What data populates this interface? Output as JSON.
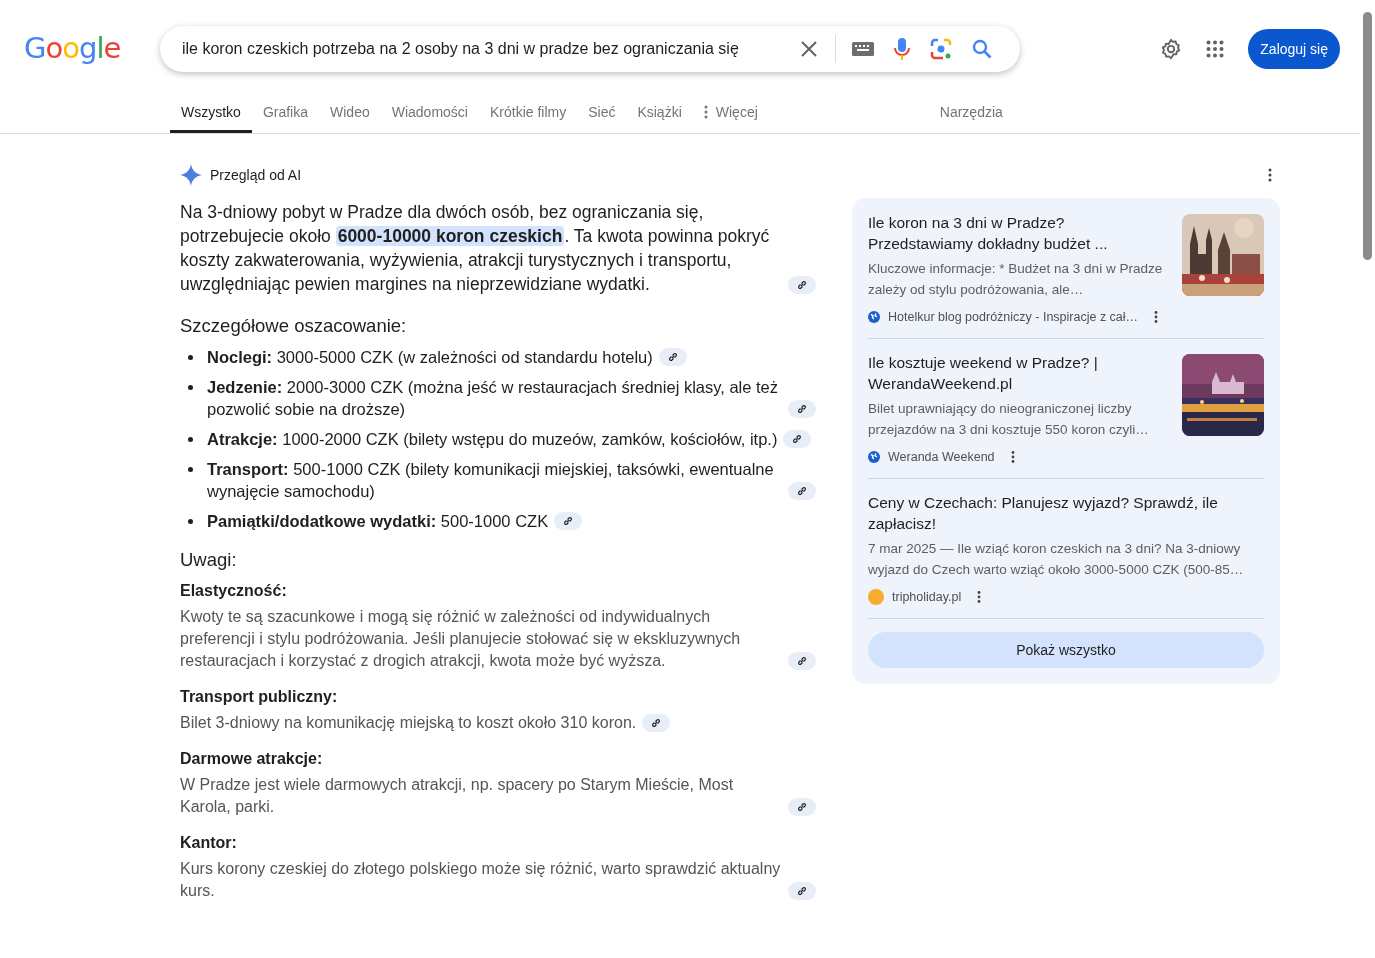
{
  "logo": "Google",
  "search": {
    "value": "ile koron czeskich potrzeba na 2 osoby na 3 dni w pradze bez ograniczania się"
  },
  "sign_in": "Zaloguj się",
  "tabs": [
    {
      "label": "Wszystko",
      "selected": true
    },
    {
      "label": "Grafika",
      "selected": false
    },
    {
      "label": "Wideo",
      "selected": false
    },
    {
      "label": "Wiadomości",
      "selected": false
    },
    {
      "label": "Krótkie filmy",
      "selected": false
    },
    {
      "label": "Sieć",
      "selected": false
    },
    {
      "label": "Książki",
      "selected": false
    },
    {
      "label": "Więcej",
      "selected": false,
      "kind": "more"
    }
  ],
  "tools": "Narzędzia",
  "ai_overview": {
    "title": "Przegląd od AI",
    "summary": "Na 3-dniowy pobyt w Pradze dla dwóch osób, bez ograniczania się, potrzebujecie około **6000-10000 koron czeskich**. Ta kwota powinna pokryć koszty zakwaterowania, wyżywienia, atrakcji turystycznych i transportu, uwzględniając pewien margines na nieprzewidziane wydatki.",
    "details_heading": "Szczegółowe oszacowanie:",
    "details": [
      "**Noclegi:** 3000-5000 CZK (w zależności od standardu hotelu)",
      "**Jedzenie:** 2000-3000 CZK (można jeść w restauracjach średniej klasy, ale też pozwolić sobie na droższe)",
      "**Atrakcje:** 1000-2000 CZK (bilety wstępu do muzeów, zamków, kościołów, itp.)",
      "**Transport:** 500-1000 CZK (bilety komunikacji miejskiej, taksówki, ewentualne wynajęcie samochodu)",
      "**Pamiątki/dodatkowe wydatki:** 500-1000 CZK"
    ],
    "notes_heading": "Uwagi:",
    "notes": [
      {
        "heading": "Elastyczność:",
        "text": "Kwoty te są szacunkowe i mogą się różnić w zależności od indywidualnych preferencji i stylu podróżowania. Jeśli planujecie stołować się w ekskluzywnych restauracjach i korzystać z drogich atrakcji, kwota może być wyższa."
      },
      {
        "heading": "Transport publiczny:",
        "text": "Bilet 3-dniowy na komunikację miejską to koszt około 310 koron."
      },
      {
        "heading": "Darmowe atrakcje:",
        "text": "W Pradze jest wiele darmowych atrakcji, np. spacery po Starym Mieście, Most Karola, parki."
      },
      {
        "heading": "Kantor:",
        "text": "Kurs korony czeskiej do złotego polskiego może się różnić, warto sprawdzić aktualny kurs."
      }
    ]
  },
  "sources": [
    {
      "title": "Ile koron na 3 dni w Pradze? Przedstawiamy dokładny budżet ...",
      "snippet": "Kluczowe informacje: * Budżet na 3 dni w Pradze zależy od stylu podróżowania, ale…",
      "site": "Hotelkur blog podróżniczy - Inspiracje z cał…",
      "kind": "globe"
    },
    {
      "title": "Ile kosztuje weekend w Pradze? | WerandaWeekend.pl",
      "snippet": "Bilet uprawniający do nieograniczonej liczby przejazdów na 3 dni kosztuje 550 koron czyli…",
      "site": "Weranda Weekend",
      "kind": "globe"
    },
    {
      "title": "Ceny w Czechach: Planujesz wyjazd? Sprawdź, ile zapłacisz!",
      "snippet": "7 mar 2025 — Ile wziąć koron czeskich na 3 dni? Na 3-dniowy wyjazd do Czech warto wziąć około 3000-5000 CZK (500-85…",
      "site": "tripholiday.pl",
      "kind": "dot",
      "color": "#f9ab2b"
    }
  ],
  "show_all": "Pokaż wszystko"
}
